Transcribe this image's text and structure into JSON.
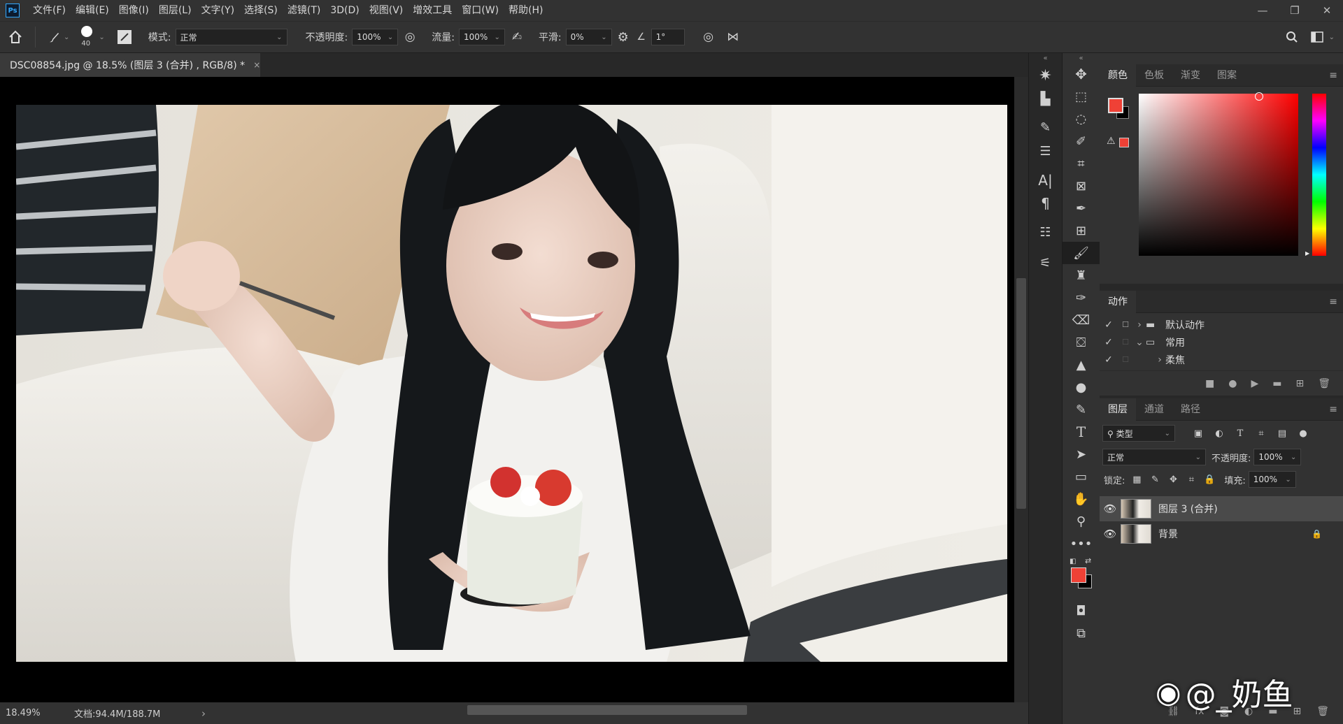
{
  "app": {
    "logo": "Ps"
  },
  "menubar": {
    "items": [
      "文件(F)",
      "编辑(E)",
      "图像(I)",
      "图层(L)",
      "文字(Y)",
      "选择(S)",
      "滤镜(T)",
      "3D(D)",
      "视图(V)",
      "增效工具",
      "窗口(W)",
      "帮助(H)"
    ]
  },
  "options": {
    "brush_size": "40",
    "mode_label": "模式:",
    "mode_value": "正常",
    "opacity_label": "不透明度:",
    "opacity_value": "100%",
    "flow_label": "流量:",
    "flow_value": "100%",
    "smooth_label": "平滑:",
    "smooth_value": "0%",
    "angle_value": "1°"
  },
  "document": {
    "tab_title": "DSC08854.jpg @ 18.5% (图层 3 (合并) , RGB/8) *",
    "close": "×"
  },
  "status": {
    "zoom": "18.49%",
    "doc_size": "文档:94.4M/188.7M",
    "arrow": "›"
  },
  "color_panel": {
    "tabs": [
      "颜色",
      "色板",
      "渐变",
      "图案"
    ],
    "foreground": "#ef4136",
    "background": "#000000",
    "hue": "#ff0000"
  },
  "actions_panel": {
    "title": "动作",
    "rows": [
      {
        "label": "默认动作",
        "expander": "›"
      },
      {
        "label": "常用",
        "expander": "⌄"
      },
      {
        "label": "柔焦",
        "expander": "›"
      }
    ]
  },
  "layers_panel": {
    "tabs": [
      "图层",
      "通道",
      "路径"
    ],
    "filter_label": "类型",
    "blend_mode": "正常",
    "opacity_label": "不透明度:",
    "opacity_value": "100%",
    "lock_label": "锁定:",
    "fill_label": "填充:",
    "fill_value": "100%",
    "layers": [
      {
        "name": "图层 3 (合并)"
      },
      {
        "name": "背景"
      }
    ],
    "fx_label": "fx"
  },
  "watermark": {
    "text": "@_奶鱼"
  }
}
